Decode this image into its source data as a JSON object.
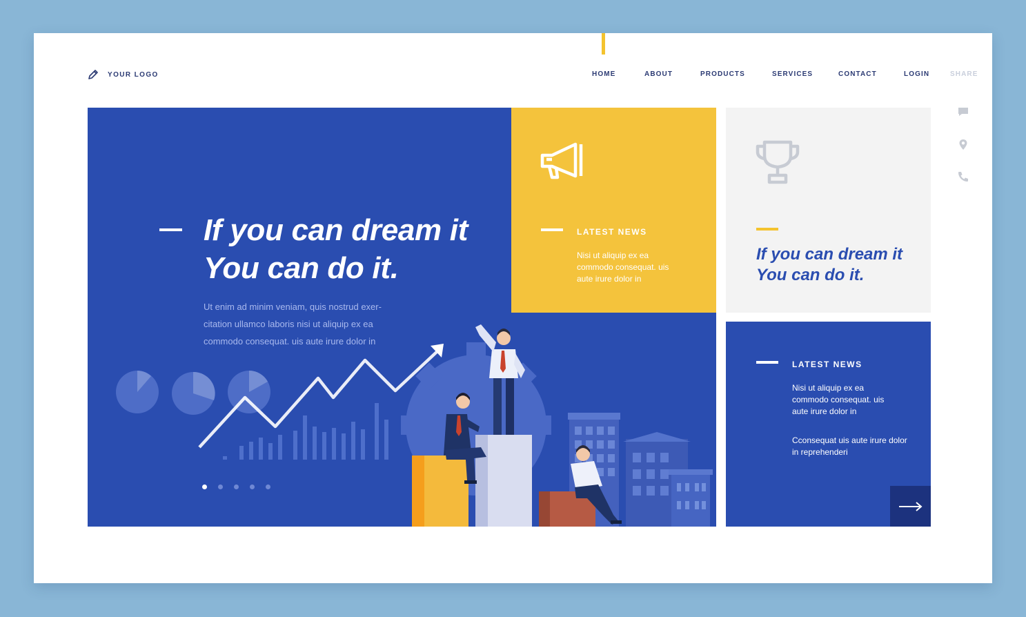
{
  "brand": {
    "logo_text": "YOUR LOGO",
    "logo_icon": "pencil-icon"
  },
  "nav": {
    "items": [
      {
        "label": "HOME"
      },
      {
        "label": "ABOUT"
      },
      {
        "label": "PRODUCTS"
      },
      {
        "label": "SERVICES"
      },
      {
        "label": "CONTACT"
      },
      {
        "label": "LOGIN"
      }
    ],
    "share_label": "SHARE"
  },
  "side_icons": [
    "chat-icon",
    "location-pin-icon",
    "phone-icon"
  ],
  "hero": {
    "title_line1": "If you can dream it",
    "title_line2": "You can do it.",
    "body": "Ut enim ad minim veniam, quis nostrud exer- citation ullamco laboris nisi ut aliquip ex ea commodo consequat. uis aute irure dolor in",
    "slides_total": 5,
    "active_slide": 1
  },
  "news_card_yellow": {
    "icon": "megaphone-icon",
    "label": "LATEST NEWS",
    "body": "Nisi ut aliquip ex ea commodo consequat. uis aute irure dolor in"
  },
  "quote_card": {
    "icon": "trophy-icon",
    "line1": "If you can dream it",
    "line2": "You can do it."
  },
  "news_card_blue": {
    "label": "LATEST NEWS",
    "body": "Nisi ut aliquip ex ea commodo consequat. uis aute irure dolor in",
    "body2": "Cconsequat uis aute irure dolor in reprehenderi",
    "arrow_icon": "arrow-right-icon"
  },
  "colors": {
    "background": "#89b6d6",
    "primary_blue": "#2a4db0",
    "dark_blue": "#1c327e",
    "accent_yellow": "#f4c33c",
    "text_navy": "#2b3a73",
    "card_gray": "#f3f3f3"
  }
}
